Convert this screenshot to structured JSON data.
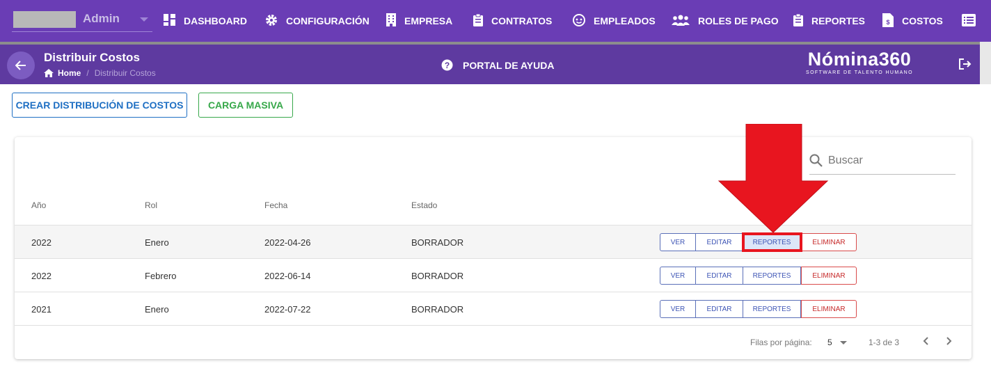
{
  "user": {
    "role": "Admin"
  },
  "nav": [
    {
      "label": "DASHBOARD",
      "icon": "dashboard-icon"
    },
    {
      "label": "CONFIGURACIÓN",
      "icon": "gear-icon"
    },
    {
      "label": "EMPRESA",
      "icon": "building-icon"
    },
    {
      "label": "CONTRATOS",
      "icon": "clipboard-icon"
    },
    {
      "label": "EMPLEADOS",
      "icon": "face-icon"
    },
    {
      "label": "ROLES DE PAGO",
      "icon": "group-icon"
    },
    {
      "label": "REPORTES",
      "icon": "report-icon"
    },
    {
      "label": "COSTOS",
      "icon": "invoice-icon"
    }
  ],
  "header": {
    "title": "Distribuir Costos",
    "breadcrumb_home": "Home",
    "breadcrumb_sep": "/",
    "breadcrumb_current": "Distribuir Costos",
    "help": "PORTAL DE AYUDA"
  },
  "brand": {
    "name": "Nómina360",
    "tagline": "SOFTWARE DE TALENTO HUMANO"
  },
  "toolbar": {
    "create_label": "CREAR DISTRIBUCIÓN DE COSTOS",
    "bulk_label": "CARGA MASIVA"
  },
  "search": {
    "placeholder": "Buscar"
  },
  "table": {
    "headers": [
      "Año",
      "Rol",
      "Fecha",
      "Estado"
    ],
    "rows": [
      {
        "year": "2022",
        "role": "Enero",
        "date": "2022-04-26",
        "status": "BORRADOR"
      },
      {
        "year": "2022",
        "role": "Febrero",
        "date": "2022-06-14",
        "status": "BORRADOR"
      },
      {
        "year": "2021",
        "role": "Enero",
        "date": "2022-07-22",
        "status": "BORRADOR"
      }
    ],
    "actions": {
      "view": "VER",
      "edit": "EDITAR",
      "reports": "REPORTES",
      "delete": "ELIMINAR"
    }
  },
  "pagination": {
    "rows_per_page_label": "Filas por página:",
    "rows_per_page": "5",
    "range": "1-3 de 3"
  },
  "colors": {
    "nav_bg": "#6a3db5",
    "header_bg": "#5e3aa0",
    "primary_blue": "#1e6fc3",
    "success_green": "#37a84a",
    "danger_red": "#c62828",
    "annotation_red": "#e8151f"
  }
}
